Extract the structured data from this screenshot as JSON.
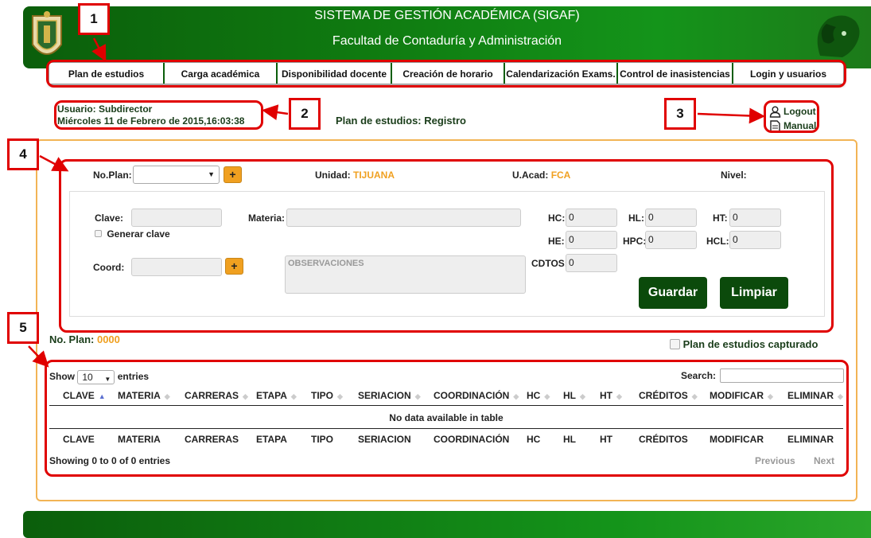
{
  "header": {
    "title": "SISTEMA DE GESTIÓN ACADÉMICA (SIGAF)",
    "subtitle": "Facultad de Contaduría y Administración",
    "logo_icon": "university-shield-icon",
    "mascot_icon": "ram-mascot-icon"
  },
  "nav": {
    "items": [
      {
        "label": "Plan de estudios"
      },
      {
        "label": "Carga académica"
      },
      {
        "label": "Disponibilidad docente"
      },
      {
        "label": "Creación de horario"
      },
      {
        "label": "Calendarización Exams."
      },
      {
        "label": "Control de inasistencias"
      },
      {
        "label": "Login y usuarios"
      }
    ]
  },
  "user": {
    "usuario": "Usuario: Subdirector",
    "fecha": "Miércoles 11 de Febrero de 2015,16:03:38"
  },
  "page_title": "Plan de estudios: Registro",
  "account": {
    "logout_label": "Logout",
    "manual_label": "Manual"
  },
  "form": {
    "no_plan_label": "No.Plan:",
    "no_plan_value": "",
    "plus_label": "+",
    "unidad_label": "Unidad:",
    "unidad_value": "TIJUANA",
    "uacad_label": "U.Acad:",
    "uacad_value": "FCA",
    "nivel_label": "Nivel:",
    "clave_label": "Clave:",
    "generar_clave_label": "Generar clave",
    "materia_label": "Materia:",
    "coord_label": "Coord:",
    "observaciones_placeholder": "OBSERVACIONES",
    "hc_label": "HC:",
    "hc_value": "0",
    "hl_label": "HL:",
    "hl_value": "0",
    "ht_label": "HT:",
    "ht_value": "0",
    "he_label": "HE:",
    "he_value": "0",
    "hpc_label": "HPC:",
    "hpc_value": "0",
    "hcl_label": "HCL:",
    "hcl_value": "0",
    "cdtos_label": "CDTOS:",
    "cdtos_value": "0",
    "guardar_label": "Guardar",
    "limpiar_label": "Limpiar"
  },
  "plan_summary": {
    "label": "No. Plan:",
    "value": "0000",
    "captured_label": "Plan de estudios capturado"
  },
  "table": {
    "show_label": "Show",
    "entries_value": "10",
    "entries_label": "entries",
    "search_label": "Search:",
    "columns": [
      "CLAVE",
      "MATERIA",
      "CARRERAS",
      "ETAPA",
      "TIPO",
      "SERIACION",
      "COORDINACIÓN",
      "HC",
      "HL",
      "HT",
      "CRÉDITOS",
      "MODIFICAR",
      "ELIMINAR"
    ],
    "empty_message": "No data available in table",
    "info": "Showing 0 to 0 of 0 entries",
    "previous_label": "Previous",
    "next_label": "Next"
  },
  "annotations": [
    "1",
    "2",
    "3",
    "4",
    "5"
  ],
  "colors": {
    "brand_green": "#0b5e0b",
    "accent_orange": "#f0a020",
    "annotation_red": "#e00000"
  }
}
